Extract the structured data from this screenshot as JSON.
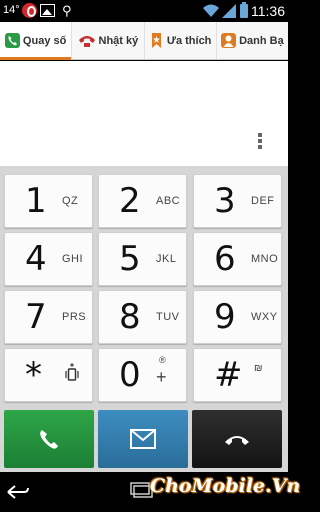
{
  "status_bar": {
    "temperature": "14°",
    "time": "11:36",
    "icons": [
      "beats-icon",
      "image-icon",
      "usb-icon",
      "wifi-icon",
      "signal-icon",
      "battery-icon"
    ]
  },
  "tabs": [
    {
      "label": "Quay số",
      "icon": "phone-icon",
      "active": true
    },
    {
      "label": "Nhật ký",
      "icon": "call-log-icon",
      "active": false
    },
    {
      "label": "Ưa thích",
      "icon": "bookmark-star-icon",
      "active": false
    },
    {
      "label": "Danh Bạ",
      "icon": "contact-icon",
      "active": false
    }
  ],
  "keypad": {
    "keys": [
      {
        "digit": "1",
        "letters": "QZ"
      },
      {
        "digit": "2",
        "letters": "ABC"
      },
      {
        "digit": "3",
        "letters": "DEF"
      },
      {
        "digit": "4",
        "letters": "GHI"
      },
      {
        "digit": "5",
        "letters": "JKL"
      },
      {
        "digit": "6",
        "letters": "MNO"
      },
      {
        "digit": "7",
        "letters": "PRS"
      },
      {
        "digit": "8",
        "letters": "TUV"
      },
      {
        "digit": "9",
        "letters": "WXY"
      },
      {
        "digit": "*",
        "letters": ""
      },
      {
        "digit": "0",
        "letters": "+"
      },
      {
        "digit": "#",
        "letters": ""
      }
    ]
  },
  "actions": {
    "call": "call-icon",
    "sms": "message-icon",
    "delete": "backspace-icon"
  },
  "colors": {
    "accent": "#e07a1f",
    "call": "#22923e",
    "sms": "#337fb0",
    "delete": "#1f1f1f"
  },
  "watermark": "ChoMobile.Vn"
}
